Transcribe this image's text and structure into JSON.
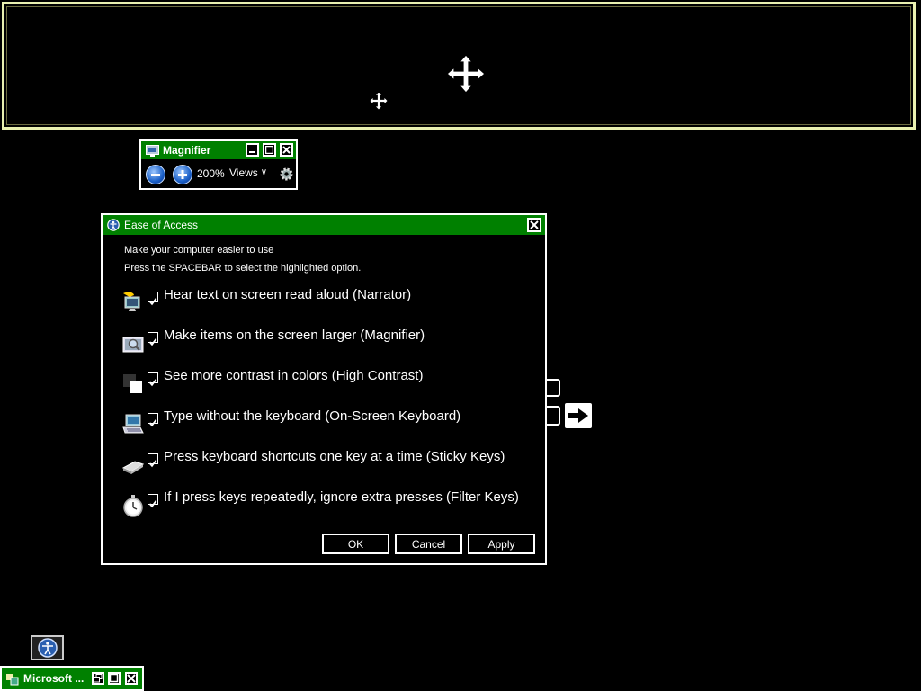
{
  "magnifier": {
    "title": "Magnifier",
    "zoom": "200%",
    "views_label": "Views",
    "views_caret": "∨"
  },
  "dialog": {
    "title": "Ease of Access",
    "intro_line1": "Make your computer easier to use",
    "intro_line2": "Press the SPACEBAR to select the highlighted option.",
    "options": [
      {
        "label": "Hear text on screen read aloud (Narrator)",
        "checked": true,
        "icon": "narrator-icon"
      },
      {
        "label": "Make items on the screen larger (Magnifier)",
        "checked": true,
        "icon": "magnifier-icon"
      },
      {
        "label": "See more contrast in colors (High Contrast)",
        "checked": true,
        "icon": "high-contrast-icon"
      },
      {
        "label": "Type without the keyboard (On-Screen Keyboard)",
        "checked": true,
        "icon": "keyboard-icon"
      },
      {
        "label": "Press keyboard shortcuts one key at a time (Sticky Keys)",
        "checked": true,
        "icon": "sticky-keys-icon"
      },
      {
        "label": "If I press keys repeatedly, ignore extra presses (Filter Keys)",
        "checked": true,
        "icon": "stopwatch-icon"
      }
    ],
    "ok_label": "OK",
    "cancel_label": "Cancel",
    "apply_label": "Apply"
  },
  "taskbar": {
    "item_label": "Microsoft ..."
  },
  "colors": {
    "titlebar": "#008000",
    "background": "#000000",
    "border": "#ffffff",
    "lens_border": "#e9f0b0"
  }
}
